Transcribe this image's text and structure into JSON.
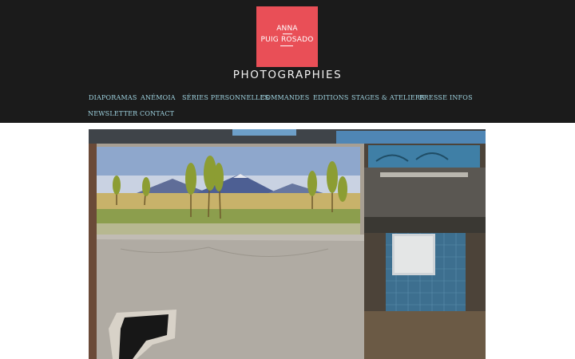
{
  "logo": {
    "line1": "ANNA",
    "line2": "PUIG ROSADO",
    "color": "#e94f57"
  },
  "site_title": "PHOTOGRAPHIES",
  "nav": {
    "items": [
      {
        "label": "DIAPORAMAS"
      },
      {
        "label": "ANÉMOIA"
      },
      {
        "label": "SÉRIES PERSONNELLES"
      },
      {
        "label": "COMMANDES"
      },
      {
        "label": "EDITIONS"
      },
      {
        "label": "STAGES & ATELIERS"
      },
      {
        "label": "PRESSE"
      },
      {
        "label": "INFOS"
      },
      {
        "label": "NEWSLETTER"
      },
      {
        "label": "CONTACT"
      }
    ],
    "color": "#9fd3e0"
  },
  "colors": {
    "header_bg": "#1b1b1b",
    "page_bg": "#ffffff"
  }
}
